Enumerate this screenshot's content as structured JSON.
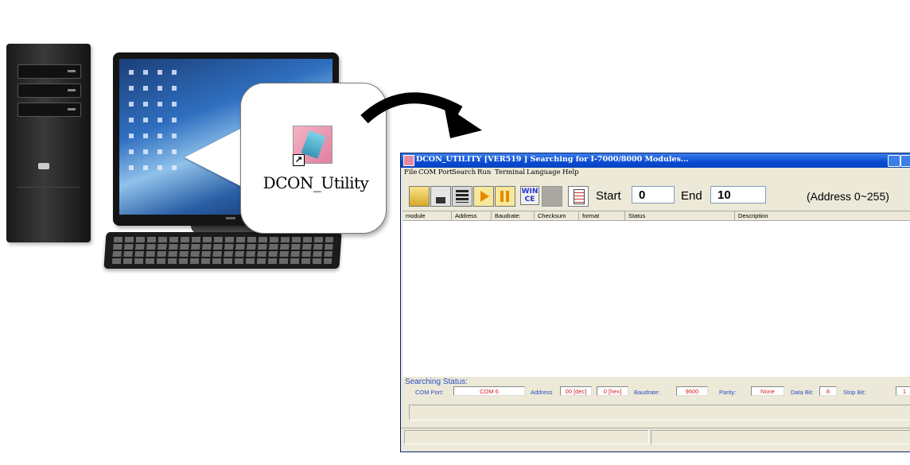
{
  "illustration": {
    "app_label": "DCON_Utility",
    "shortcut_glyph": "↗"
  },
  "window": {
    "title": "DCON_UTILITY [VER519 ] Searching for I-7000/8000 Modules...",
    "menu": [
      "File",
      "COM Port",
      "Search",
      "Run",
      "Terminal",
      "Language",
      "Help"
    ],
    "toolbar": {
      "wince_line1": "WIN",
      "wince_line2": "CE",
      "start_label": "Start",
      "start_value": "0",
      "end_label": "End",
      "end_value": "10",
      "address_note": "(Address 0~255)"
    },
    "list_columns": [
      "module",
      "Address",
      "Baudrate:",
      "Checksum",
      "format",
      "Status",
      "Description"
    ],
    "searching_status": {
      "title": "Searching Status:",
      "com_port_label": "COM Port:",
      "com_port_value": "COM 6",
      "address_label": "Address",
      "address_dec": "00 [dec]",
      "address_hex": "0 [hex]",
      "baudrate_label": "Baudrate:",
      "baudrate_value": "9600",
      "parity_label": "Parity:",
      "parity_value": "None",
      "data_bit_label": "Data Bit:",
      "data_bit_value": "8",
      "stop_bit_label": "Stop Bit:",
      "stop_bit_value": "1"
    }
  },
  "colors": {
    "title_bar": "#0a4bd2",
    "status_text": "#2b4fbf",
    "value_text": "#d42020",
    "arrow": "#000000"
  }
}
